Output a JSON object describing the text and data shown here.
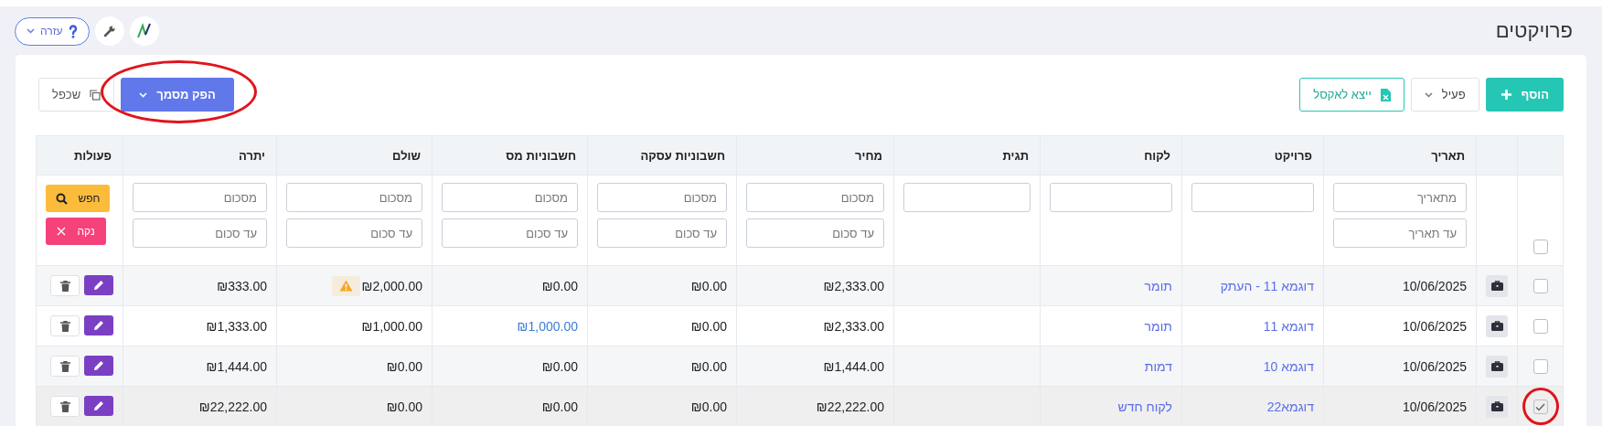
{
  "page": {
    "title": "פרויקטים"
  },
  "header_tools": {
    "help_button": "עזרה"
  },
  "toolbar": {
    "add_button": "הוסף",
    "status_filter": "פעיל",
    "export_button": "ייצא לאקסל",
    "generate_button": {
      "label": "הפק מסמך",
      "highlighted": true
    },
    "duplicate_button": "שכפל"
  },
  "table": {
    "select_all_checked": false,
    "columns": [
      {
        "label": "תאריך",
        "kind": "range",
        "placeholders": [
          "מתאריך",
          "עד תאריך"
        ]
      },
      {
        "label": "פרויקט",
        "kind": "text"
      },
      {
        "label": "לקוח",
        "kind": "text"
      },
      {
        "label": "תגית",
        "kind": "text"
      },
      {
        "label": "מחיר",
        "kind": "range",
        "placeholders": [
          "מסכום",
          "עד סכום"
        ]
      },
      {
        "label": "חשבוניות עסקה",
        "kind": "range",
        "placeholders": [
          "מסכום",
          "עד סכום"
        ]
      },
      {
        "label": "חשבוניות מס",
        "kind": "range",
        "placeholders": [
          "מסכום",
          "עד סכום"
        ]
      },
      {
        "label": "שולם",
        "kind": "range",
        "placeholders": [
          "מסכום",
          "עד סכום"
        ]
      },
      {
        "label": "יתרה",
        "kind": "range",
        "placeholders": [
          "מסכום",
          "עד סכום"
        ]
      },
      {
        "label": "פעולות",
        "kind": "actions"
      }
    ],
    "filter_actions": {
      "search_button": "חפש",
      "clear_button": "נקה"
    },
    "rows": [
      {
        "checked": false,
        "highlighted": false,
        "date": "10/06/2025",
        "project": "דוגמא 11 - העתק",
        "client": "תומר",
        "price": "₪2,333.00",
        "business_invoices": "₪0.00",
        "tax_invoices": {
          "text": "₪0.00",
          "linked": false
        },
        "paid": {
          "text": "₪2,000.00",
          "warning": true
        },
        "balance": "₪333.00"
      },
      {
        "checked": false,
        "highlighted": false,
        "date": "10/06/2025",
        "project": "דוגמא 11",
        "client": "תומר",
        "price": "₪2,333.00",
        "business_invoices": "₪0.00",
        "tax_invoices": {
          "text": "₪1,000.00",
          "linked": true
        },
        "paid": {
          "text": "₪1,000.00",
          "warning": false
        },
        "balance": "₪1,333.00"
      },
      {
        "checked": false,
        "highlighted": false,
        "date": "10/06/2025",
        "project": "דוגמא 10",
        "client": "דמות",
        "price": "₪1,444.00",
        "business_invoices": "₪0.00",
        "tax_invoices": {
          "text": "₪0.00",
          "linked": false
        },
        "paid": {
          "text": "₪0.00",
          "warning": false
        },
        "balance": "₪1,444.00"
      },
      {
        "checked": true,
        "highlighted": true,
        "date": "10/06/2025",
        "project": "דוגמא22",
        "client": "לקוח חדש",
        "price": "₪22,222.00",
        "business_invoices": "₪0.00",
        "tax_invoices": {
          "text": "₪0.00",
          "linked": false
        },
        "paid": {
          "text": "₪0.00",
          "warning": false
        },
        "balance": "₪22,222.00"
      }
    ]
  }
}
